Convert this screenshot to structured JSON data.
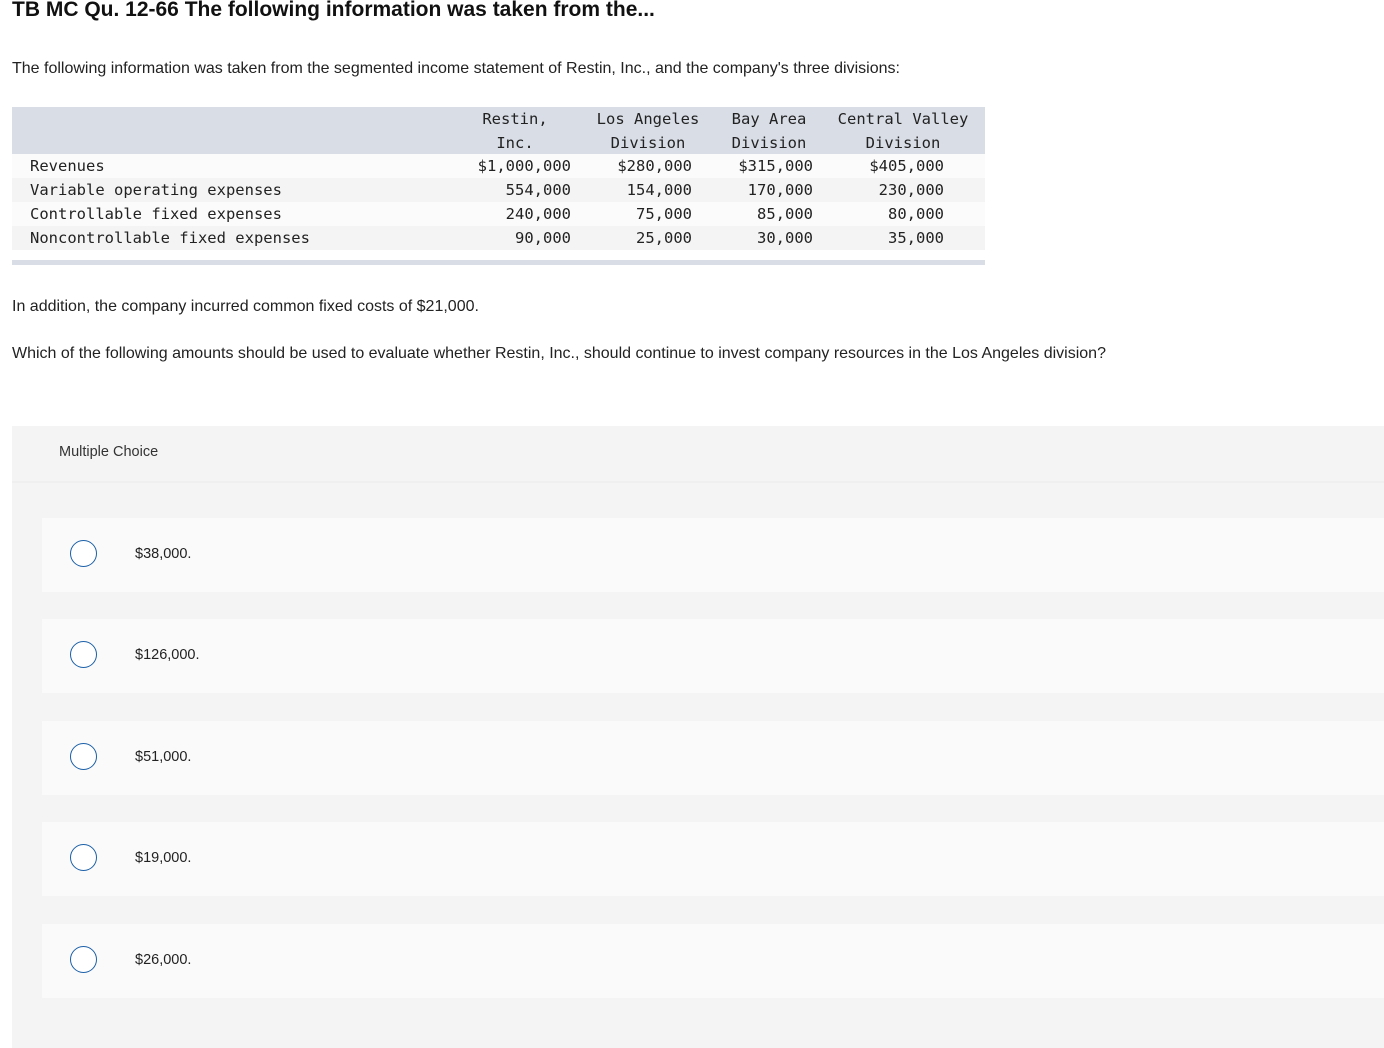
{
  "title": "TB MC Qu. 12-66 The following information was taken from the...",
  "intro": "The following information was taken from the segmented income statement of Restin, Inc., and the company's three divisions:",
  "table": {
    "headers": [
      {
        "line1": "Restin,",
        "line2": "Inc."
      },
      {
        "line1": "Los Angeles",
        "line2": "Division"
      },
      {
        "line1": "Bay Area",
        "line2": "Division"
      },
      {
        "line1": "Central Valley",
        "line2": "Division"
      }
    ],
    "rows": [
      {
        "label": "Revenues",
        "values": [
          "$1,000,000",
          "$280,000",
          "$315,000",
          "$405,000"
        ]
      },
      {
        "label": "Variable operating expenses",
        "values": [
          "554,000",
          "154,000",
          "170,000",
          "230,000"
        ]
      },
      {
        "label": "Controllable fixed expenses",
        "values": [
          "240,000",
          "75,000",
          "85,000",
          "80,000"
        ]
      },
      {
        "label": "Noncontrollable fixed expenses",
        "values": [
          "90,000",
          "25,000",
          "30,000",
          "35,000"
        ]
      }
    ]
  },
  "addition": "In addition, the company incurred common fixed costs of $21,000.",
  "question": "Which of the following amounts should be used to evaluate whether Restin, Inc., should continue to invest company resources in the Los Angeles division?",
  "multiple_choice": {
    "label": "Multiple Choice",
    "options": [
      "$38,000.",
      "$126,000.",
      "$51,000.",
      "$19,000.",
      "$26,000."
    ]
  },
  "colors": {
    "header_bg": "#d8dde6",
    "panel_bg": "#f4f4f4",
    "radio_border": "#1a5fa8"
  }
}
